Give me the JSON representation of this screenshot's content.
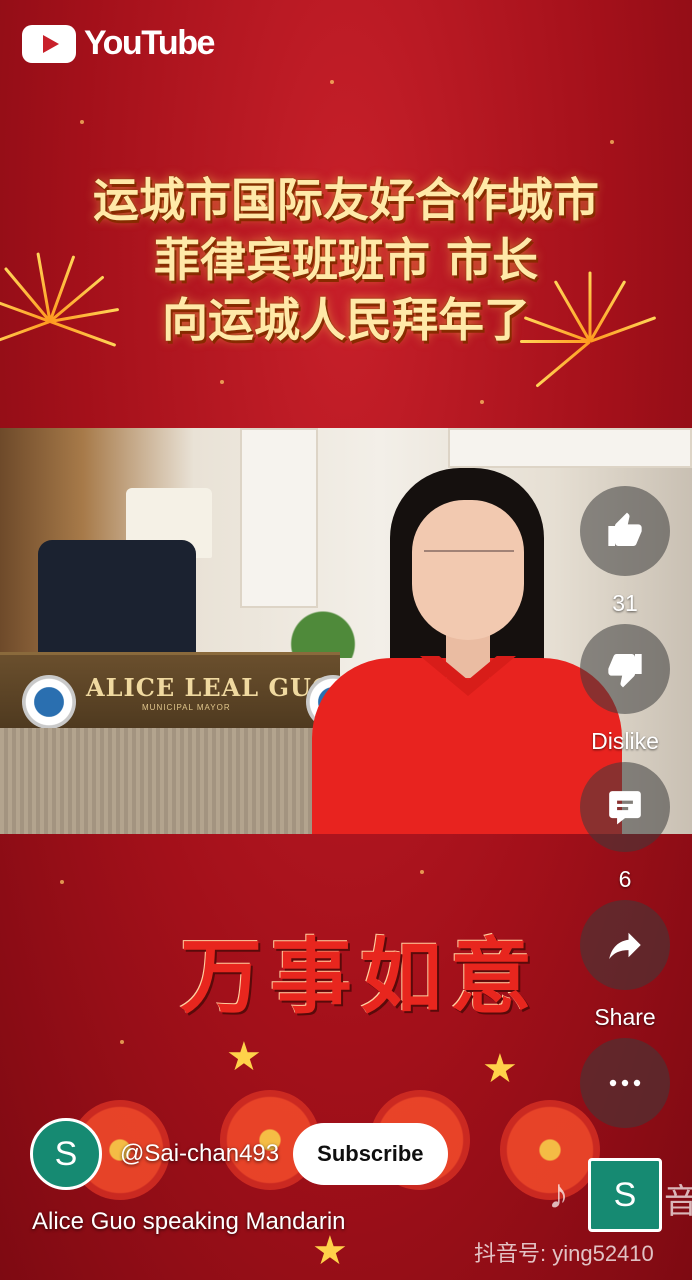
{
  "app": {
    "logo_text": "YouTube"
  },
  "video": {
    "banner_lines": [
      "运城市国际友好合作城市",
      "菲律宾班班市 市长",
      "向运城人民拜年了"
    ],
    "nameplate": {
      "name": "ALICE LEAL GUO",
      "role": "MUNICIPAL MAYOR"
    },
    "greeting": "万事如意",
    "watermark": "抖音号: ying52410",
    "douyin_partial": "音"
  },
  "actions": {
    "like": {
      "icon": "thumbs-up-icon",
      "label": "31"
    },
    "dislike": {
      "icon": "thumbs-down-icon",
      "label": "Dislike"
    },
    "comments": {
      "icon": "comment-icon",
      "label": "6"
    },
    "share": {
      "icon": "share-arrow-icon",
      "label": "Share"
    },
    "more": {
      "icon": "more-dots-icon"
    }
  },
  "channel": {
    "avatar_letter": "S",
    "handle": "@Sai-chan493",
    "subscribe_label": "Subscribe"
  },
  "title": "Alice Guo speaking Mandarin",
  "colors": {
    "background_red": "#a3101a",
    "accent_teal": "#168a72"
  }
}
